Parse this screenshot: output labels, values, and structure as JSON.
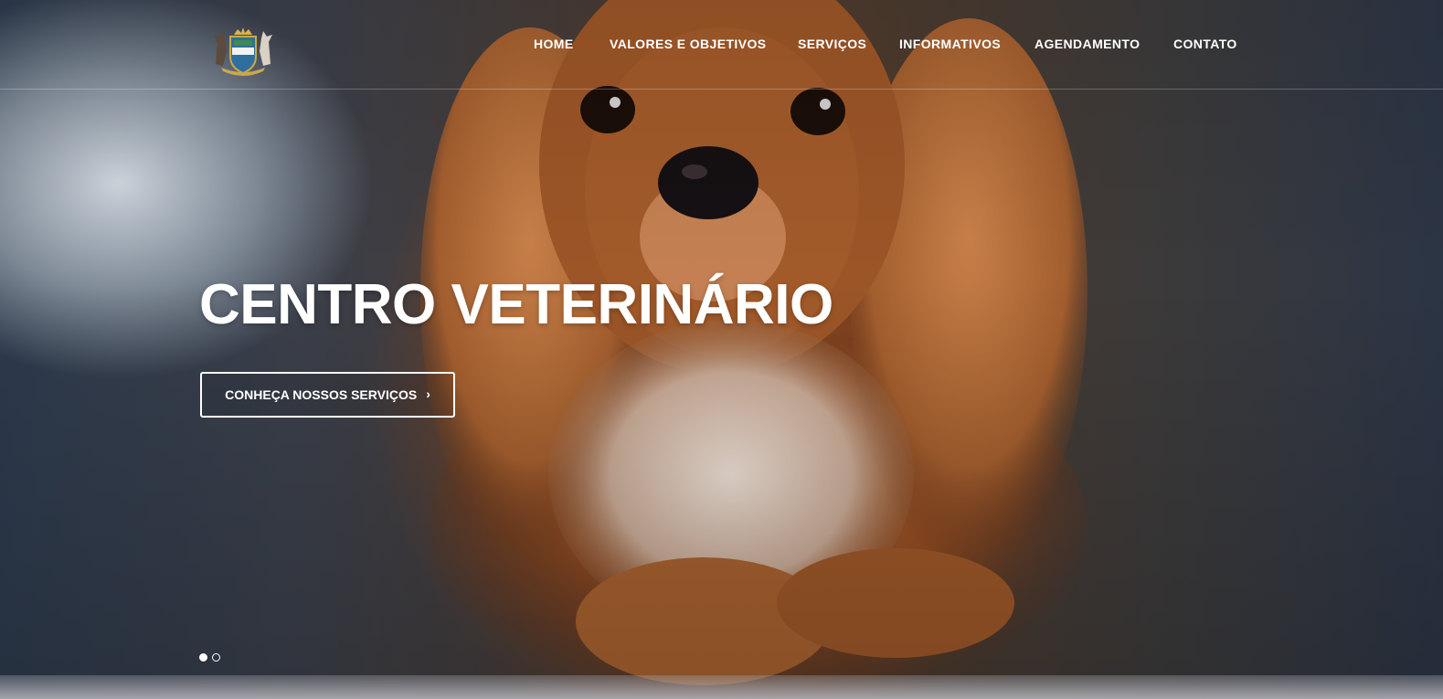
{
  "nav": {
    "items": [
      {
        "label": "HOME"
      },
      {
        "label": "VALORES E OBJETIVOS"
      },
      {
        "label": "SERVIÇOS"
      },
      {
        "label": "INFORMATIVOS"
      },
      {
        "label": "AGENDAMENTO"
      },
      {
        "label": "CONTATO"
      }
    ]
  },
  "hero": {
    "title": "CENTRO VETERINÁRIO",
    "cta_label": "CONHEÇA NOSSOS SERVIÇOS",
    "cta_icon": "chevron-right-icon",
    "background": "dog-photo",
    "slides": {
      "count": 2,
      "active": 1
    }
  },
  "colors": {
    "text": "#ffffff",
    "fur": "#9a5428"
  }
}
